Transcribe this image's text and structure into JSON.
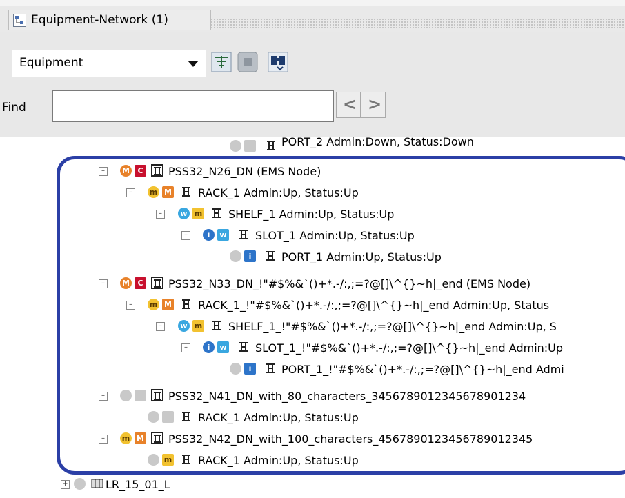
{
  "window": {
    "title_tab": "Equipment-Network (1)",
    "title_icon": "tree-network-icon"
  },
  "toolbar": {
    "view_dropdown": "Equipment",
    "buttons": [
      "collapse-tree-icon",
      "stop-icon",
      "find-icon"
    ],
    "find_label": "Find",
    "find_value": "",
    "nav_prev": "<",
    "nav_next": ">"
  },
  "tree": {
    "rows": [
      {
        "label": "PORT_2 Admin:Down, Status:Down"
      },
      {
        "label": "PSS32_N26_DN (EMS Node)"
      },
      {
        "label": "RACK_1 Admin:Up, Status:Up"
      },
      {
        "label": "SHELF_1 Admin:Up, Status:Up"
      },
      {
        "label": "SLOT_1 Admin:Up, Status:Up"
      },
      {
        "label": "PORT_1 Admin:Up, Status:Up"
      },
      {
        "label": "PSS32_N33_DN_!\"#$%&`()+*.-/:,;=?@[]\\^{}~h|_end (EMS Node)"
      },
      {
        "label": "RACK_1_!\"#$%&`()+*.-/:,;=?@[]\\^{}~h|_end Admin:Up, Status"
      },
      {
        "label": "SHELF_1_!\"#$%&`()+*.-/:,;=?@[]\\^{}~h|_end Admin:Up, S"
      },
      {
        "label": "SLOT_1_!\"#$%&`()+*.-/:,;=?@[]\\^{}~h|_end Admin:Up"
      },
      {
        "label": "PORT_1_!\"#$%&`()+*.-/:,;=?@[]\\^{}~h|_end Admi"
      },
      {
        "label": "PSS32_N41_DN_with_80_characters_3456789012345678901234"
      },
      {
        "label": "RACK_1 Admin:Up, Status:Up"
      },
      {
        "label": "PSS32_N42_DN_with_100_characters_4567890123456789012345"
      },
      {
        "label": "RACK_1 Admin:Up, Status:Up"
      },
      {
        "label": "LR_15_01_L"
      }
    ],
    "badge_letters": {
      "M": "M",
      "C": "C",
      "m": "m",
      "w": "w",
      "i": "i"
    }
  },
  "colors": {
    "highlight": "#2b3fa6",
    "major_orange": "#e8822a",
    "critical_red": "#c8102e",
    "minor_yellow": "#f2c230",
    "warning_cyan": "#3aa7e0",
    "info_blue": "#2d74c9",
    "clear_gray": "#c9c9c9"
  }
}
